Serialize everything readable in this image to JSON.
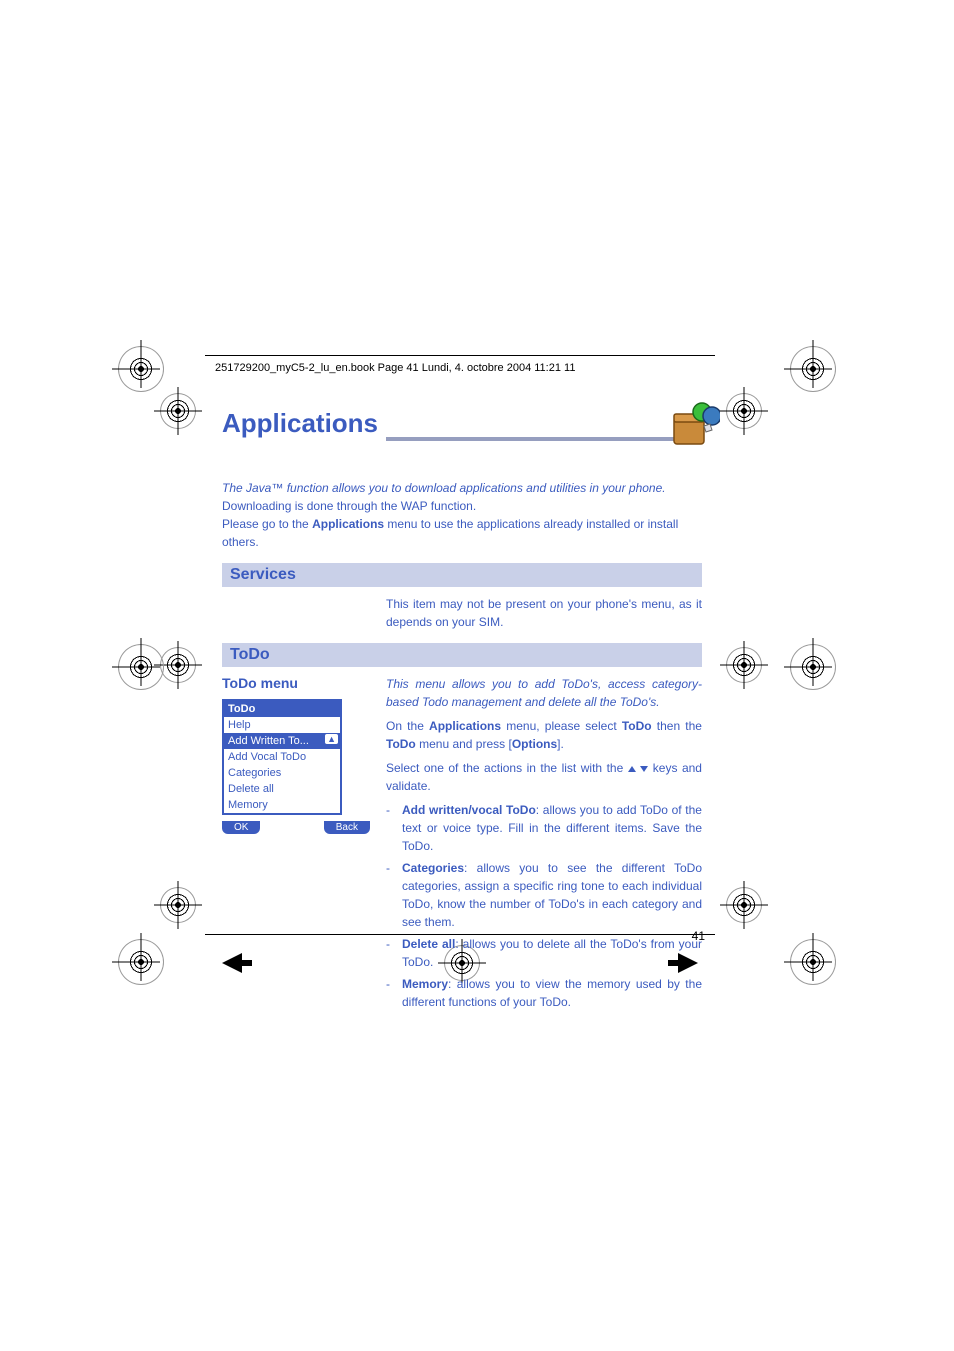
{
  "header": "251729200_myC5-2_lu_en.book  Page 41  Lundi, 4. octobre 2004  11:21 11",
  "title": "Applications",
  "intro": {
    "line1": "The Java™ function allows you to download applications and utilities in your phone.",
    "line2": "Downloading is done through the WAP function.",
    "line3_pre": "Please go to the ",
    "line3_bold": "Applications",
    "line3_post": " menu to use the applications already installed or install others."
  },
  "sections": {
    "services": {
      "heading": "Services",
      "body": "This item may not be present on your phone's menu, as it depends on your SIM."
    },
    "todo": {
      "heading": "ToDo",
      "subhead": "ToDo menu",
      "intro_italic": "This menu allows you to add ToDo's, access category-based Todo management and delete all the ToDo's.",
      "para2_pre": "On the ",
      "para2_b1": "Applications",
      "para2_mid": " menu, please select ",
      "para2_b2": "ToDo",
      "para2_mid2": " then the ",
      "para2_b3": "ToDo",
      "para2_post": " menu and press [",
      "para2_b4": "Options",
      "para2_end": "].",
      "para3_pre": "Select one of the actions in the list with the ",
      "para3_post": " keys and validate.",
      "bullets": [
        {
          "bold": "Add written/vocal ToDo",
          "rest": ": allows you to add ToDo of the text or voice type. Fill in the different items. Save the ToDo."
        },
        {
          "bold": "Categories",
          "rest": ": allows you to see the different ToDo categories, assign a specific ring tone to each individual ToDo, know the number of ToDo's in each category and see them."
        },
        {
          "bold": "Delete all",
          "rest": ": allows you to delete all the ToDo's from your ToDo."
        },
        {
          "bold": "Memory",
          "rest": ": allows you to view the memory used by the different functions of your ToDo."
        }
      ]
    }
  },
  "phone": {
    "title": "ToDo",
    "items": [
      "Help",
      "Add Written To...",
      "Add Vocal ToDo",
      "Categories",
      "Delete all",
      "Memory"
    ],
    "selected_index": 1,
    "sk_left": "OK",
    "sk_right": "Back"
  },
  "page_number": "41"
}
